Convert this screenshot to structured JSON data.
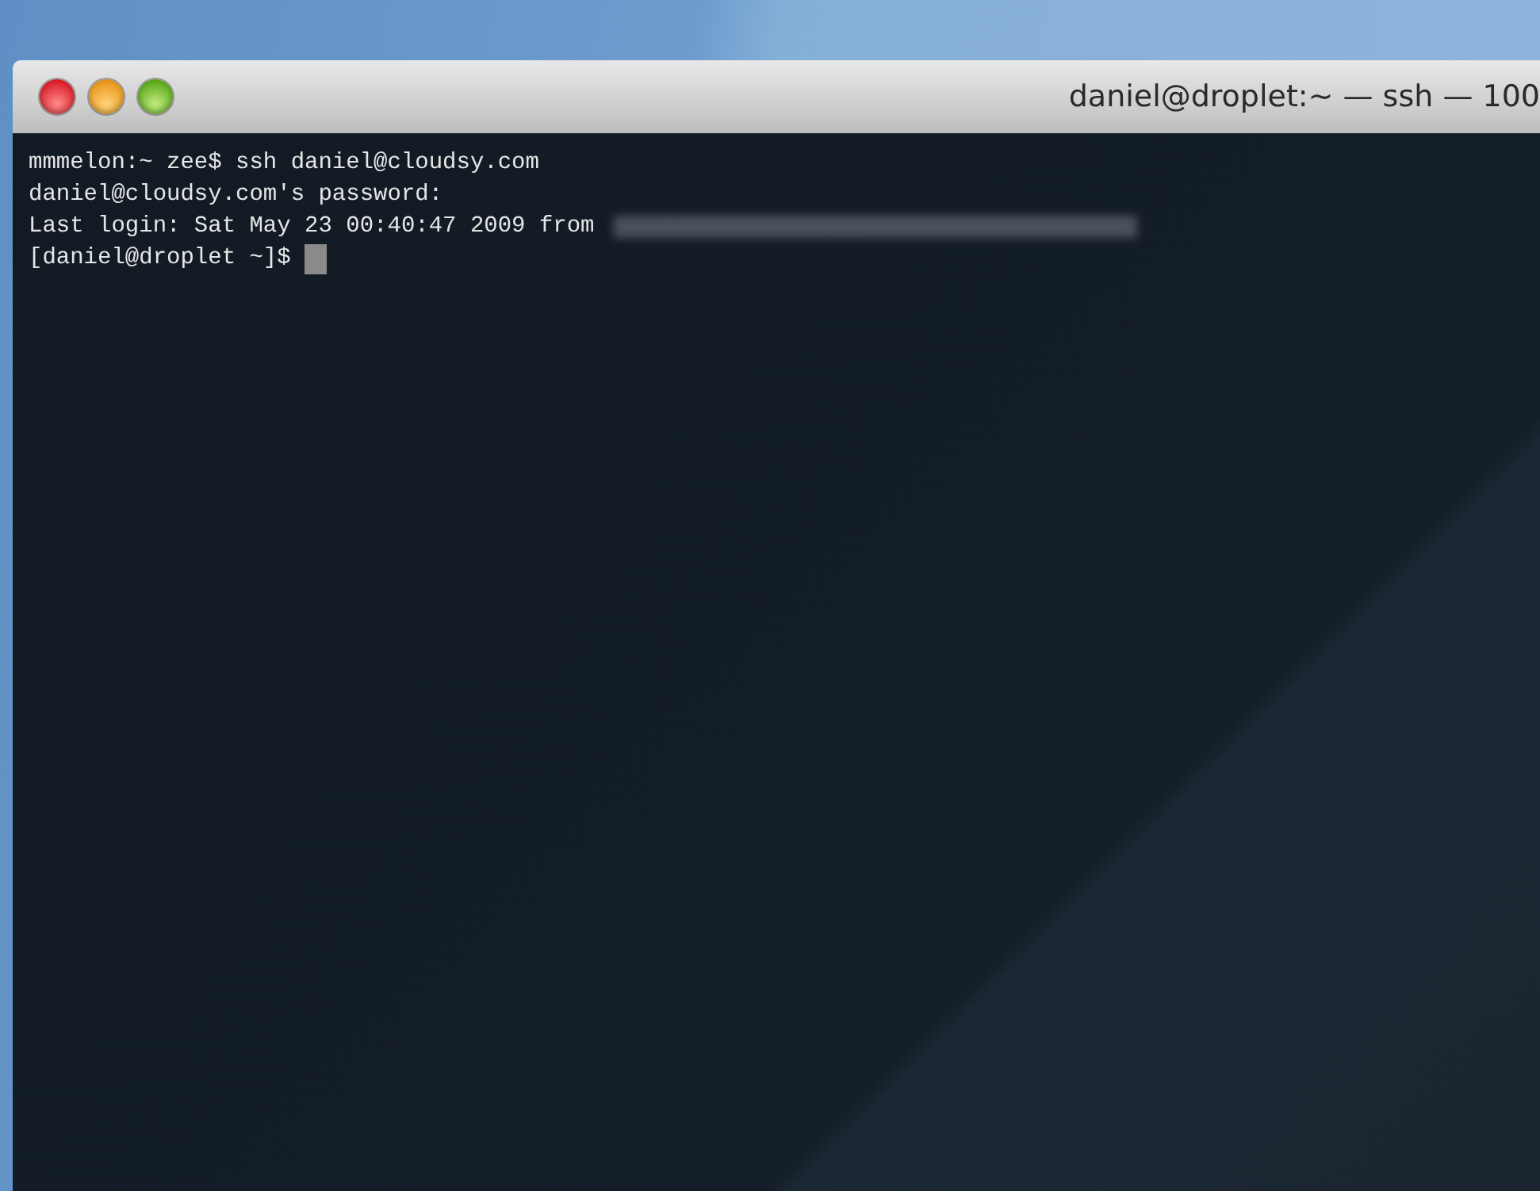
{
  "window": {
    "title": "daniel@droplet:~ — ssh — 100"
  },
  "terminal": {
    "lines": [
      {
        "text": "mmmelon:~ zee$ ssh daniel@cloudsy.com",
        "redacted": false,
        "cursor": false
      },
      {
        "text": "daniel@cloudsy.com's password:",
        "redacted": false,
        "cursor": false
      },
      {
        "text": "Last login: Sat May 23 00:40:47 2009 from",
        "redacted": true,
        "cursor": false
      },
      {
        "text": "[daniel@droplet ~]$",
        "redacted": false,
        "cursor": true
      }
    ]
  }
}
